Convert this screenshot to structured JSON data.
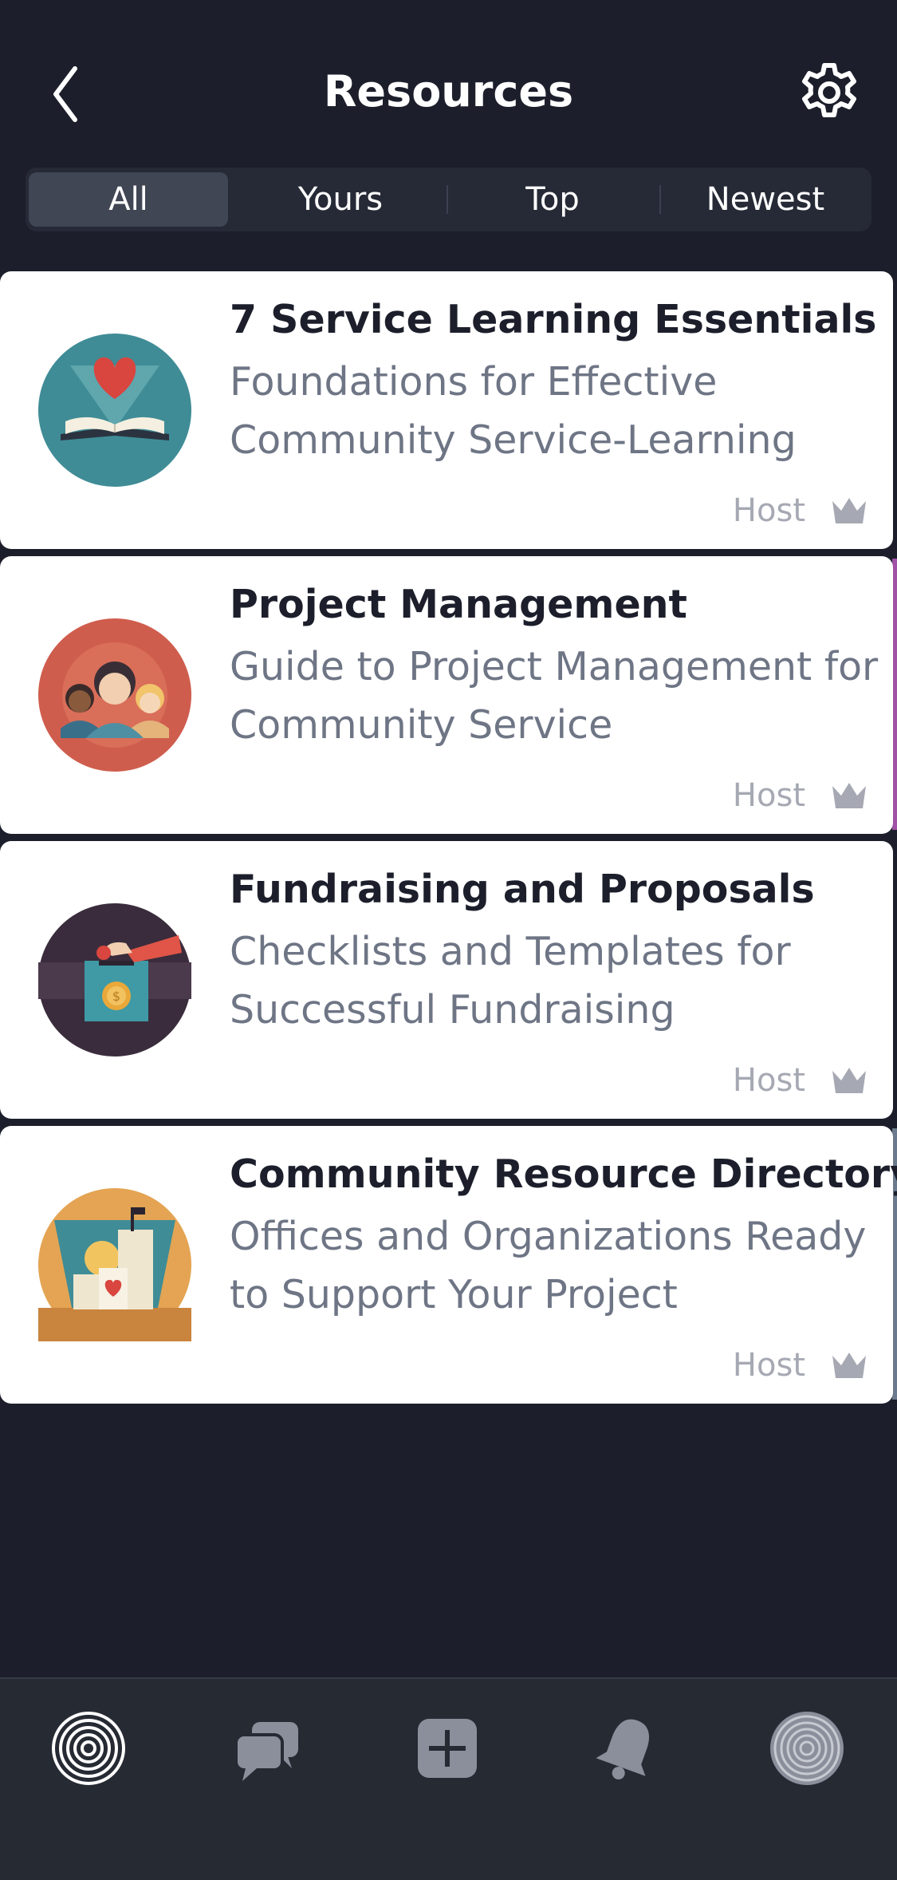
{
  "header": {
    "title": "Resources",
    "back_icon": "chevron-left-icon",
    "settings_icon": "gear-icon"
  },
  "filters": {
    "items": [
      "All",
      "Yours",
      "Top",
      "Newest"
    ],
    "selected": "All"
  },
  "resources": [
    {
      "title": "7 Service Learning Essentials",
      "subtitle": "Foundations for Effective Community Service-Learning",
      "role": "Host",
      "icon": "book-heart-icon"
    },
    {
      "title": "Project Management",
      "subtitle": "Guide to Project Management for Community Service",
      "role": "Host",
      "icon": "people-group-icon"
    },
    {
      "title": "Fundraising and Proposals",
      "subtitle": "Checklists and Templates for Successful Fundraising",
      "role": "Host",
      "icon": "donation-box-icon"
    },
    {
      "title": "Community Resource Directory",
      "subtitle": "Offices and Organizations Ready to Support Your Project",
      "role": "Host",
      "icon": "city-heart-icon"
    }
  ],
  "colors": {
    "background": "#1c1f2b",
    "card": "#ffffff",
    "accent_pink": "#a052a6",
    "accent_slate": "#6b7a8c",
    "muted": "#a6a9b3"
  },
  "tabbar": {
    "icons": [
      "home-spiral-icon",
      "chat-bubbles-icon",
      "add-plus-icon",
      "bell-icon",
      "profile-spiral-icon"
    ]
  }
}
